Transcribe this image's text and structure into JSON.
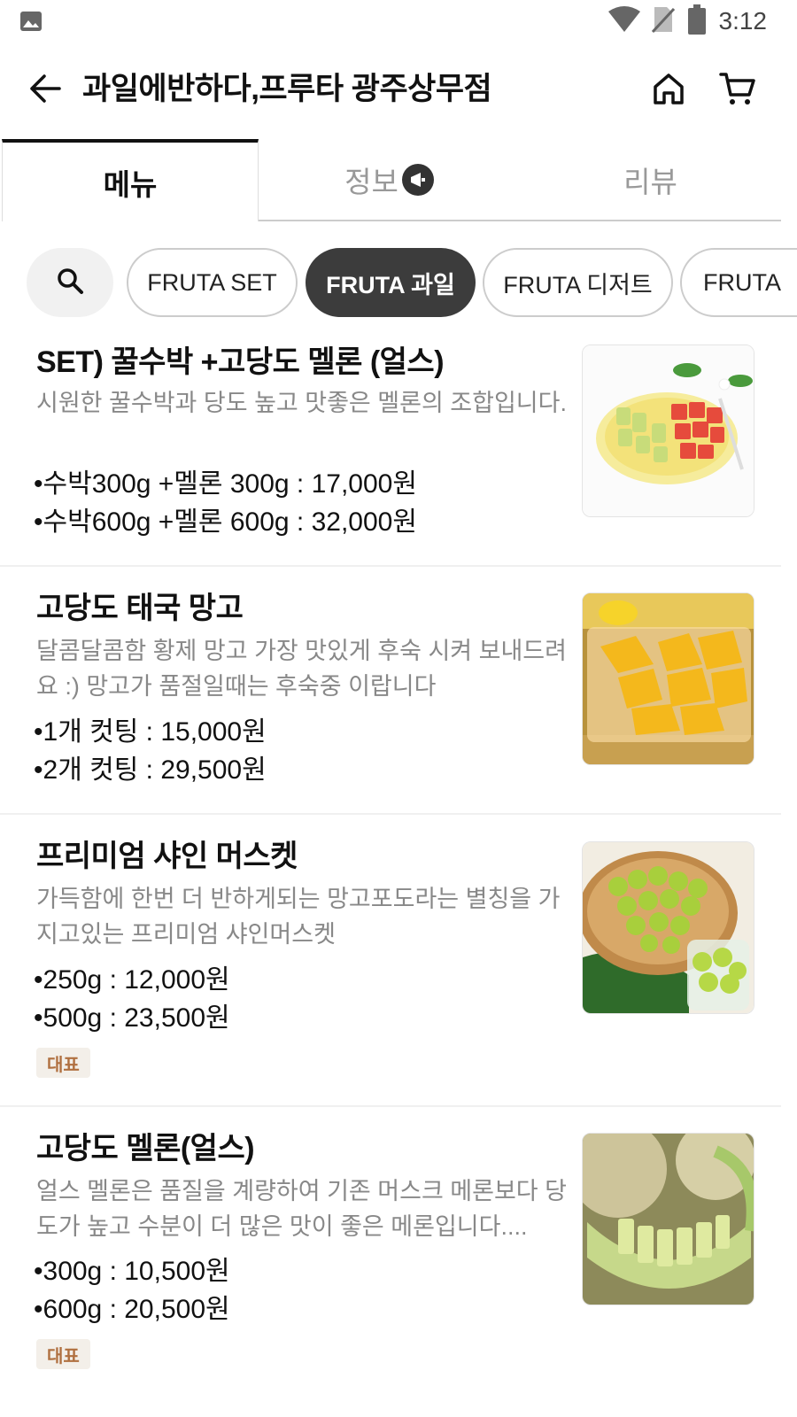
{
  "status_bar": {
    "time": "3:12",
    "icons": [
      "gallery-icon",
      "wifi-icon",
      "no-sim-icon",
      "battery-icon"
    ]
  },
  "header": {
    "title": "과일에반하다,프루타 광주상무점",
    "icons": [
      "back-arrow-icon",
      "home-icon",
      "cart-icon"
    ]
  },
  "tabs": [
    {
      "label": "메뉴",
      "active": true
    },
    {
      "label": "정보",
      "active": false
    },
    {
      "label": "리뷰",
      "active": false
    }
  ],
  "categories": [
    {
      "label": "FRUTA  SET",
      "active": false
    },
    {
      "label": "FRUTA 과일",
      "active": true
    },
    {
      "label": "FRUTA 디저트",
      "active": false
    },
    {
      "label": "FRUTA",
      "active": false
    }
  ],
  "menu_items": [
    {
      "name": "SET) 꿀수박 +고당도 멜론 (얼스)",
      "description": "시원한 꿀수박과 당도 높고 맛좋은 멜론의 조합입니다.",
      "prices": [
        "•수박300g +멜론 300g : 17,000원",
        "•수박600g +멜론 600g : 32,000원"
      ],
      "image": "watermelon-melon-plate"
    },
    {
      "name": "고당도  태국 망고",
      "description": "달콤달콤함 황제 망고 가장 맛있게 후숙 시켜 보내드려요 :) 망고가 품절일때는 후숙중 이랍니다",
      "prices": [
        "•1개  컷팅 : 15,000원",
        "•2개 컷팅 : 29,500원"
      ],
      "image": "cut-mango"
    },
    {
      "name": "프리미엄 샤인 머스켓",
      "description": "가득함에 한번 더 반하게되는 망고포도라는 별칭을 가지고있는 프리미엄 샤인머스켓",
      "prices": [
        "•250g : 12,000원",
        "•500g : 23,500원"
      ],
      "tag": "대표",
      "image": "shine-muscat-grapes"
    },
    {
      "name": "고당도 멜론(얼스)",
      "description": "얼스 멜론은 품질을 계량하여 기존 머스크 메론보다 당도가 높고 수분이 더 많은 맛이 좋은 메론입니다....",
      "prices": [
        "•300g : 10,500원",
        "•600g : 20,500원"
      ],
      "tag": "대표",
      "image": "sliced-melon"
    }
  ],
  "colors": {
    "active_chip_bg": "#3c3c3c",
    "tag_bg": "#f3efe9",
    "tag_text": "#b07040",
    "desc_text": "#888888"
  }
}
